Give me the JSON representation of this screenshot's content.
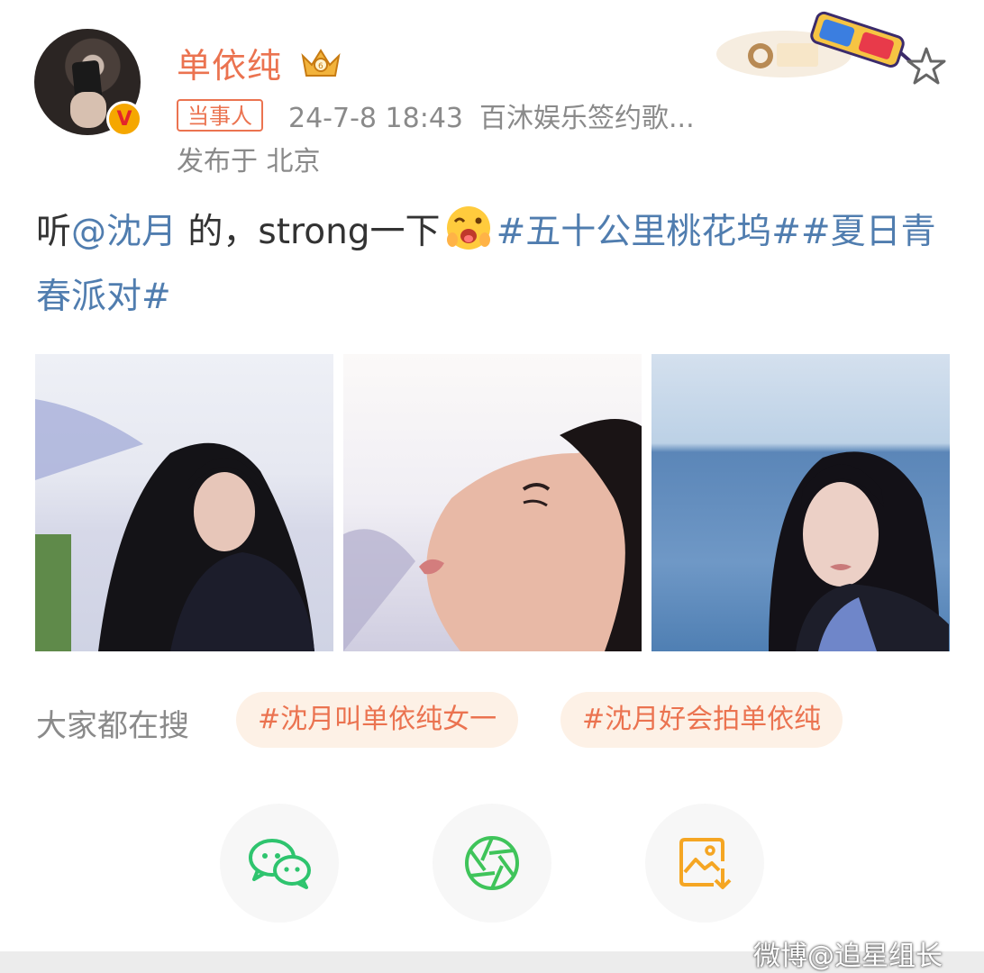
{
  "post": {
    "author": {
      "name": "单依纯",
      "tag": "当事人",
      "verified_badge": "V",
      "colors": {
        "name": "#eb7350",
        "badge": "#f5a700"
      }
    },
    "meta": {
      "timestamp": "24-7-8 18:43",
      "source": "百沐娱乐签约歌...",
      "location": "发布于 北京"
    },
    "text": {
      "prefix": "听",
      "mention": "@沈月",
      "middle": " 的，strong一下",
      "hashtag1": "#五十公里桃花坞#",
      "hashtag2": "#夏日青春派对#",
      "emoji": "wink-face"
    },
    "images": [
      {
        "alt": "photo-1"
      },
      {
        "alt": "photo-2"
      },
      {
        "alt": "photo-3"
      }
    ],
    "trending": {
      "label": "大家都在搜",
      "chips": [
        "#沈月叫单依纯女一",
        "#沈月好会拍单依纯"
      ]
    },
    "share": {
      "buttons": [
        "wechat-icon",
        "moments-icon",
        "save-image-icon"
      ]
    },
    "watermark": "微博@追星组长"
  },
  "colors": {
    "link": "#507daf",
    "accent": "#eb7350",
    "meta": "#8a8a8a",
    "chip_bg": "#fdf1e6",
    "wechat": "#2ec46e",
    "moments": "#3fc45a",
    "save": "#f5a623"
  }
}
